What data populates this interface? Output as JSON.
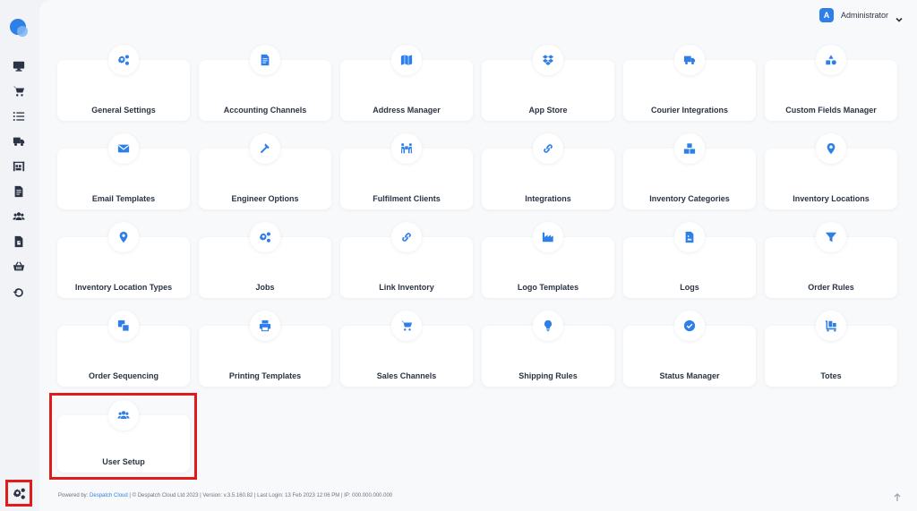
{
  "user": {
    "initial": "A",
    "name": "Administrator"
  },
  "sidebar": {
    "items": [
      {
        "icon": "desktop-icon"
      },
      {
        "icon": "cart-icon"
      },
      {
        "icon": "list-icon"
      },
      {
        "icon": "truck-icon"
      },
      {
        "icon": "warehouse-icon"
      },
      {
        "icon": "document-icon"
      },
      {
        "icon": "users-icon"
      },
      {
        "icon": "file-invoice-icon"
      },
      {
        "icon": "basket-icon"
      },
      {
        "icon": "undo-icon"
      }
    ],
    "active": "cogs-icon"
  },
  "cards": [
    {
      "label": "General Settings",
      "icon": "cogs-icon"
    },
    {
      "label": "Accounting Channels",
      "icon": "document-icon"
    },
    {
      "label": "Address Manager",
      "icon": "map-icon"
    },
    {
      "label": "App Store",
      "icon": "dropbox-icon"
    },
    {
      "label": "Courier Integrations",
      "icon": "truck-icon"
    },
    {
      "label": "Custom Fields Manager",
      "icon": "shapes-icon"
    },
    {
      "label": "Email Templates",
      "icon": "envelope-icon"
    },
    {
      "label": "Engineer Options",
      "icon": "hammer-icon"
    },
    {
      "label": "Fulfilment Clients",
      "icon": "people-carry-icon"
    },
    {
      "label": "Integrations",
      "icon": "link-icon"
    },
    {
      "label": "Inventory Categories",
      "icon": "boxes-icon"
    },
    {
      "label": "Inventory Locations",
      "icon": "map-marker-icon"
    },
    {
      "label": "Inventory Location Types",
      "icon": "map-pin-icon"
    },
    {
      "label": "Jobs",
      "icon": "cogs-icon"
    },
    {
      "label": "Link Inventory",
      "icon": "link-icon"
    },
    {
      "label": "Logo Templates",
      "icon": "industry-icon"
    },
    {
      "label": "Logs",
      "icon": "file-image-icon"
    },
    {
      "label": "Order Rules",
      "icon": "filter-icon"
    },
    {
      "label": "Order Sequencing",
      "icon": "clone-icon"
    },
    {
      "label": "Printing Templates",
      "icon": "print-icon"
    },
    {
      "label": "Sales Channels",
      "icon": "cart-icon"
    },
    {
      "label": "Shipping Rules",
      "icon": "lightbulb-icon"
    },
    {
      "label": "Status Manager",
      "icon": "check-circle-icon"
    },
    {
      "label": "Totes",
      "icon": "dolly-icon"
    }
  ],
  "user_setup": {
    "label": "User Setup",
    "icon": "users-icon"
  },
  "footer": {
    "prefix": "Powered by: ",
    "link": "Despatch Cloud",
    "rest": " | © Despatch Cloud Ltd 2023 | Version: v.3.5.160.82 | Last Login: 13 Feb 2023 12:06 PM | IP: 000.000.000.000"
  },
  "colors": {
    "accent": "#2f7fe8",
    "highlight": "#e01b1b",
    "text": "#2b3344"
  }
}
